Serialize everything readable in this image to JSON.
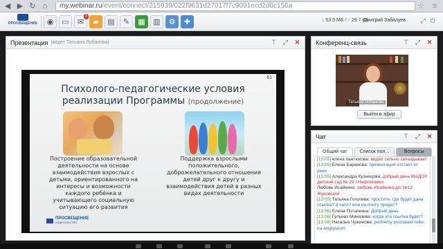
{
  "browser": {
    "url_host": "my.webinar.ru",
    "url_path": "/event/connect/215939/022f9631d27017f7c9091ecd2d0c156a"
  },
  "toolbar": {
    "logo_text": "ПРОСВЕЩЕНИЕ",
    "notification_count": "3",
    "stats": "↓ 53.5 МБ / ↑ 29.7 КБ",
    "user_name": "Дмитрий Забалуев"
  },
  "presentation": {
    "title": "Презентация",
    "subtitle": "(ведет Татьяна Лобанова)",
    "slide": {
      "number": "61",
      "title": "Психолого-педагогические условия реализации Программы",
      "title_suffix": "(продолжение)",
      "left_text": "Построение образовательной деятельности на основе взаимодействия взрослых с детьми, ориентированного на интересы и возможности каждого ребёнка и учитывающего социальную ситуацию его развития",
      "right_text": "Поддержка взрослыми положительного, доброжелательного отношения детей друг к другу и взаимодействия детей в разных видах деятельности",
      "logo": "ПРОСВЕЩЕНИЕ",
      "logo_sub": "ИЗДАТЕЛЬСТВО"
    }
  },
  "conference": {
    "title": "Конференц-связь",
    "speaker_name": "Татьяна Лобанова",
    "air_button": "Выйти в эфир"
  },
  "chat": {
    "title": "Чат",
    "tabs": [
      "Общий чат",
      "Список пол...",
      "Вопросы"
    ],
    "messages": [
      {
        "time": "[13:05]",
        "name": "елена пантюхова:",
        "text": "видео сильно запаздывает",
        "color": "#c72a2a"
      },
      {
        "time": "[13:05]",
        "name": "Елена Баранова:",
        "text": "презентация отстает от речи",
        "color": "#1b6ed2"
      },
      {
        "time": "[13:05]",
        "name": "Александра Кузнецова:",
        "text": "добрый день МАДОУ детский сад № 29 г.Нефтекамск",
        "color": "#c72a2a"
      },
      {
        "time": "",
        "name": "Любовь Исайкина:",
        "text": "любовь Исайкина-д/с №12 Жуковский",
        "color": "#c72a2a"
      },
      {
        "time": "[13:05]",
        "name": "Татьяна Гоголева:",
        "text": "простите, где будет дана ссылка? в чате? или на почту придет?",
        "color": "#1b6ed2"
      },
      {
        "time": "[13:06]",
        "name": "Елена Потапкина:",
        "text": "Добрый день",
        "color": "#1b6ed2"
      },
      {
        "time": "[13:06]",
        "name": "Гульназ Минязева:",
        "text": "когда эта ссылка будет?",
        "color": "#1b6ed2"
      },
      {
        "time": "[13:06]",
        "name": "Наталья Чужинова:",
        "text": "pochemy pechataet tolko na angliyskom",
        "color": "#1b6ed2"
      }
    ]
  },
  "colors": {
    "brand": "#1d4e9e",
    "close": "#d0312d",
    "time": "#3a9a3a"
  }
}
